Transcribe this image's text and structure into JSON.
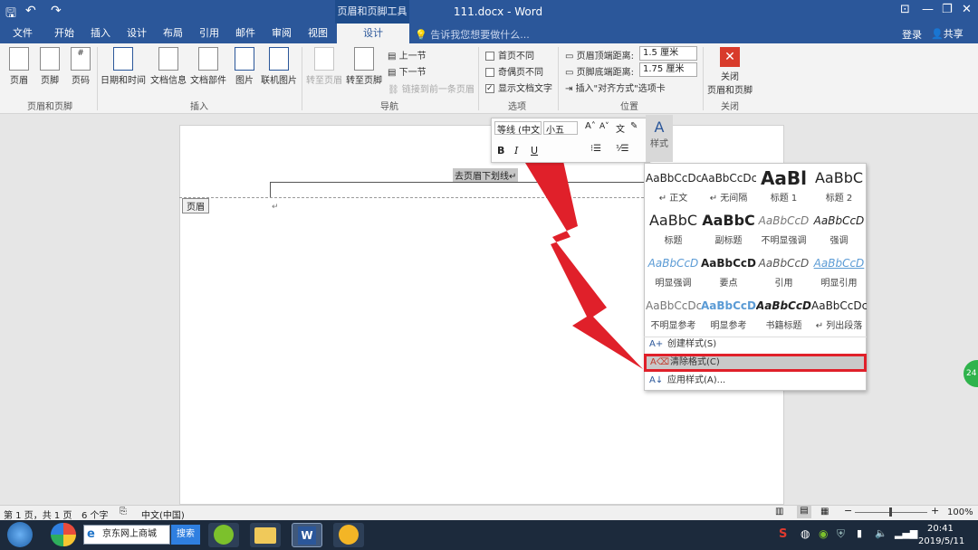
{
  "quick_access": {
    "save": "🖫",
    "undo": "↶",
    "redo": "↷"
  },
  "title_bar": {
    "context_tools": "页眉和页脚工具",
    "doc_title": "111.docx - Word"
  },
  "window_controls": {
    "ribbon_opts": "⊡",
    "minimize": "—",
    "restore": "❐",
    "close": "✕"
  },
  "tabs": [
    "文件",
    "开始",
    "插入",
    "设计",
    "布局",
    "引用",
    "邮件",
    "审阅",
    "视图",
    "设计"
  ],
  "tell_me": "告诉我您想要做什么...",
  "account": {
    "login": "登录",
    "share": "共享"
  },
  "ribbon": {
    "header_footer": {
      "header": "页眉",
      "footer": "页脚",
      "page_num": "页码",
      "group": "页眉和页脚"
    },
    "insert": {
      "datetime": "日期和时间",
      "docinfo": "文档信息",
      "docparts": "文档部件",
      "picture": "图片",
      "online_picture": "联机图片",
      "group": "插入"
    },
    "navigation": {
      "goto_header": "转至页眉",
      "goto_footer": "转至页脚",
      "prev": "上一节",
      "next": "下一节",
      "link_prev": "链接到前一条页眉",
      "group": "导航"
    },
    "options": {
      "first_page": "首页不同",
      "odd_even": "奇偶页不同",
      "show_text": "显示文档文字",
      "group": "选项"
    },
    "position": {
      "header_top_label": "页眉顶端距离:",
      "header_top_value": "1.5 厘米",
      "footer_bottom_label": "页脚底端距离:",
      "footer_bottom_value": "1.75 厘米",
      "insert_align": "插入\"对齐方式\"选项卡",
      "group": "位置"
    },
    "close": {
      "label_line1": "关闭",
      "label_line2": "页眉和页脚",
      "group": "关闭"
    }
  },
  "mini_toolbar": {
    "font": "等线 (中文",
    "size": "小五",
    "bold": "B",
    "italic": "I",
    "underline": "U",
    "styles_label": "样式"
  },
  "document": {
    "selected_text": "去页眉下划线",
    "header_tag": "页眉",
    "para_mark": "↵"
  },
  "styles_gallery": {
    "items": [
      {
        "sample": "AaBbCcDc",
        "name": "↵ 正文"
      },
      {
        "sample": "AaBbCcDc",
        "name": "↵ 无间隔"
      },
      {
        "sample": "AaBl",
        "name": "标题 1"
      },
      {
        "sample": "AaBbC",
        "name": "标题 2"
      },
      {
        "sample": "AaBbC",
        "name": "标题"
      },
      {
        "sample": "AaBbC",
        "name": "副标题"
      },
      {
        "sample": "AaBbCcD",
        "name": "不明显强调"
      },
      {
        "sample": "AaBbCcD",
        "name": "强调"
      },
      {
        "sample": "AaBbCcD",
        "name": "明显强调"
      },
      {
        "sample": "AaBbCcD",
        "name": "要点"
      },
      {
        "sample": "AaBbCcD",
        "name": "引用"
      },
      {
        "sample": "AaBbCcD",
        "name": "明显引用"
      },
      {
        "sample": "AaBbCcDc",
        "name": "不明显参考"
      },
      {
        "sample": "AaBbCcD",
        "name": "明显参考"
      },
      {
        "sample": "AaBbCcD",
        "name": "书籍标题"
      },
      {
        "sample": "AaBbCcDc",
        "name": "↵ 列出段落"
      }
    ],
    "create": "创建样式(S)",
    "clear": "清除格式(C)",
    "apply": "应用样式(A)..."
  },
  "status_bar": {
    "page": "第 1 页，共 1 页",
    "words": "6 个字",
    "lang": "中文(中国)",
    "zoom": "100%"
  },
  "taskbar": {
    "search_text": "京东网上商城",
    "search_btn": "搜索",
    "time": "20:41",
    "date": "2019/5/11"
  },
  "colors": {
    "word_blue": "#2b579a",
    "highlight_red": "#e0202a"
  }
}
